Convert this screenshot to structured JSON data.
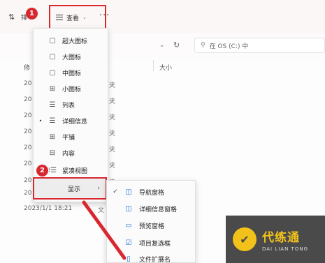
{
  "toolbar": {
    "sort_label": "排",
    "view_label": "查看",
    "more_label": "···"
  },
  "annotations": {
    "badge1": "1",
    "badge2": "2"
  },
  "search": {
    "text": "在 OS (C:) 中"
  },
  "columns": {
    "modified": "修",
    "size": "大小"
  },
  "rows": [
    {
      "date": "20",
      "type": "夹"
    },
    {
      "date": "20",
      "type": "夹"
    },
    {
      "date": "20",
      "type": "夹"
    },
    {
      "date": "20",
      "type": "夹"
    },
    {
      "date": "20",
      "type": "夹"
    },
    {
      "date": "20",
      "type": "夹"
    },
    {
      "date": "20",
      "type": "夹"
    },
    {
      "date": "20",
      "type": ""
    }
  ],
  "last_row": {
    "date": "2023/1/1 18:21",
    "type": "文"
  },
  "view_menu": {
    "items": [
      {
        "label": "超大图标",
        "icon": "monitor-icon"
      },
      {
        "label": "大图标",
        "icon": "monitor-icon"
      },
      {
        "label": "中图标",
        "icon": "monitor-icon"
      },
      {
        "label": "小图标",
        "icon": "grid-icon"
      },
      {
        "label": "列表",
        "icon": "list-icon"
      },
      {
        "label": "详细信息",
        "icon": "details-icon",
        "selected": true
      },
      {
        "label": "平铺",
        "icon": "tiles-icon"
      },
      {
        "label": "内容",
        "icon": "content-icon"
      },
      {
        "label": "紧凑视图",
        "icon": "compact-icon"
      }
    ],
    "show_label": "显示"
  },
  "show_submenu": {
    "items": [
      {
        "label": "导航窗格",
        "checked": true
      },
      {
        "label": "详细信息窗格",
        "checked": false
      },
      {
        "label": "预览窗格",
        "checked": false
      },
      {
        "label": "项目复选框",
        "checked": false
      },
      {
        "label": "文件扩展名",
        "checked": false
      }
    ]
  },
  "watermark": {
    "title": "代练通",
    "subtitle": "DAI LIAN TONG"
  },
  "colors": {
    "highlight_red": "#d8282f",
    "watermark_gold": "#f2c21b"
  }
}
